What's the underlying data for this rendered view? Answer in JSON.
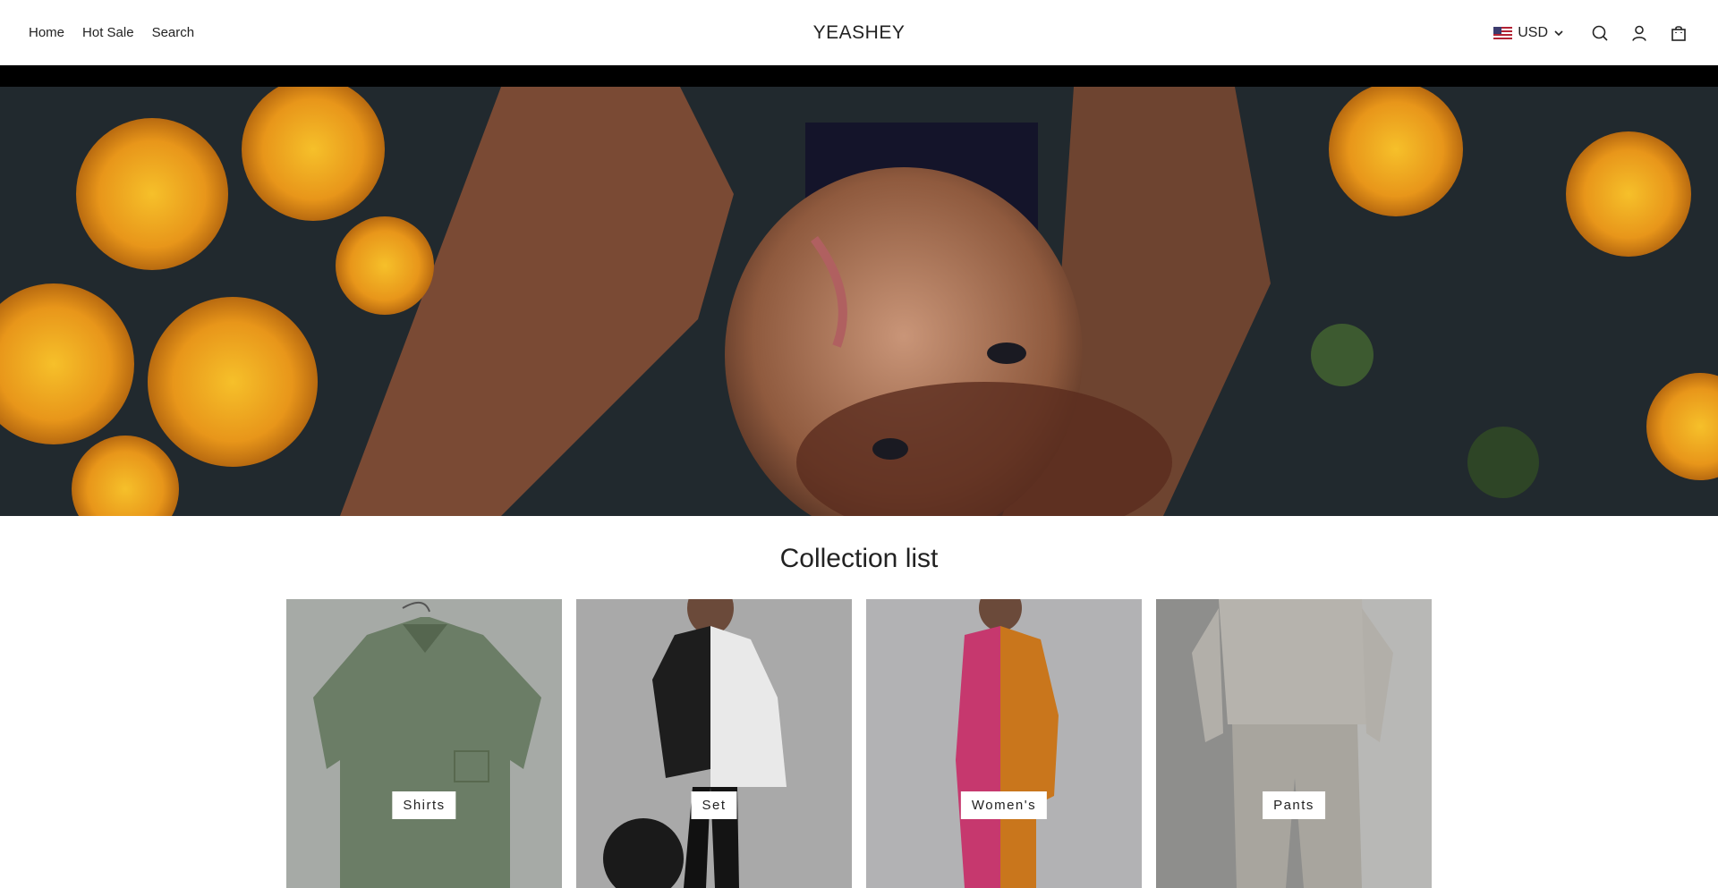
{
  "header": {
    "nav": [
      "Home",
      "Hot Sale",
      "Search"
    ],
    "logo": "YEASHEY",
    "currency": "USD",
    "icons": [
      "us-flag-icon",
      "chevron-down-icon",
      "search-icon",
      "account-icon",
      "cart-icon"
    ]
  },
  "hero": {
    "image": "woman-lying-in-flowers"
  },
  "collection": {
    "title": "Collection list",
    "items": [
      {
        "label": "Shirts"
      },
      {
        "label": "Set"
      },
      {
        "label": "Women's"
      },
      {
        "label": "Pants"
      }
    ]
  },
  "colors": {
    "text": "#222222",
    "background": "#ffffff",
    "hero_bar": "#000000"
  }
}
